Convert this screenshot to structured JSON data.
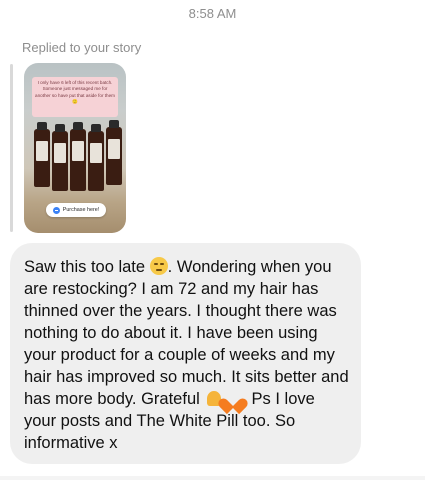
{
  "header": {
    "time": "8:58 AM"
  },
  "reply": {
    "label": "Replied to your story"
  },
  "story": {
    "note_text": "I only have 6 left of this recent batch. Someone just messaged me for another so have put that aside for them 🙂",
    "purchase_label": "Purchase here!"
  },
  "message": {
    "part1": "Saw this too late ",
    "part2": ". Wondering when you are restocking? I am 72 and my hair has thinned over the years. I thought there was nothing to do about it. I have been using your product for a couple of weeks and my hair has improved so much. It sits better and has more body. Grateful ",
    "part3": ". Ps I love your posts and The White Pill too. So informative x",
    "emojis": [
      "pensive-face",
      "folded-hands",
      "orange-heart"
    ]
  },
  "colors": {
    "bubble_bg": "#efefef",
    "meta_text": "#8e8e8e",
    "note_pink": "#f6d2d6"
  }
}
